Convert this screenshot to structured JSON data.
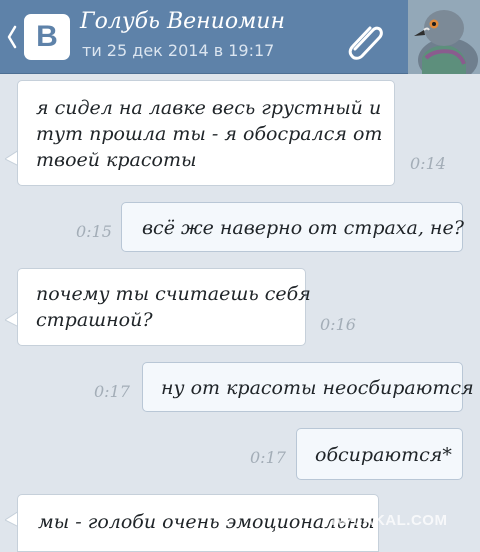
{
  "header": {
    "contact_name": "Голубь Вениомин",
    "last_seen": "ти 25 дек 2014 в 19:17",
    "back_icon": "back-chevron-icon",
    "logo_letter": "В",
    "attach_icon": "paperclip-icon",
    "avatar": "pigeon-avatar"
  },
  "colors": {
    "header_bg": "#5e82a9",
    "chat_bg": "#dfe5ec",
    "bubble_in": "#ffffff",
    "bubble_out": "#f4f8fc",
    "time_text": "#a3adb7"
  },
  "messages": [
    {
      "direction": "incoming",
      "text": "я сидел на лавке весь грустный и\nтут прошла ты - я обосрался от\nтвоей красоты",
      "time": "0:14"
    },
    {
      "direction": "outgoing",
      "text": "всё же наверно от страха, не?",
      "time": "0:15"
    },
    {
      "direction": "incoming",
      "text": "почему ты считаешь себя\nстрашной?",
      "time": "0:16"
    },
    {
      "direction": "outgoing",
      "text": "ну от красоты неосбираются",
      "time": "0:17"
    },
    {
      "direction": "outgoing",
      "text": "обсираются*",
      "time": "0:17"
    },
    {
      "direction": "incoming",
      "text": "мы - голоби очень эмоциональны",
      "time": ""
    }
  ],
  "watermark": "YAPLAKAL.COM"
}
